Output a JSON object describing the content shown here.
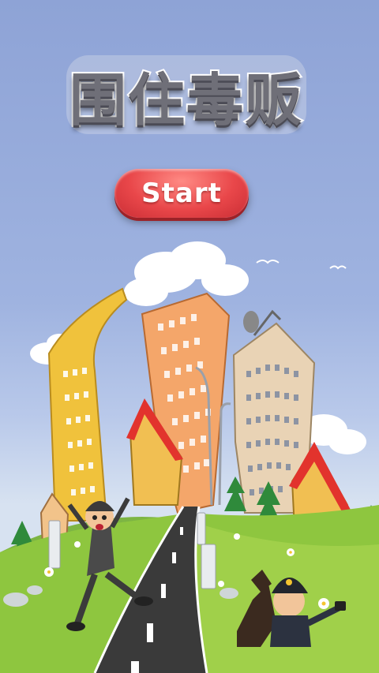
{
  "game": {
    "title": "围住毒贩",
    "start_label": "Start"
  },
  "colors": {
    "sky": "#8ea3d6",
    "button": "#e9474a",
    "grass": "#8ec63f",
    "road": "#3a3a3a"
  }
}
